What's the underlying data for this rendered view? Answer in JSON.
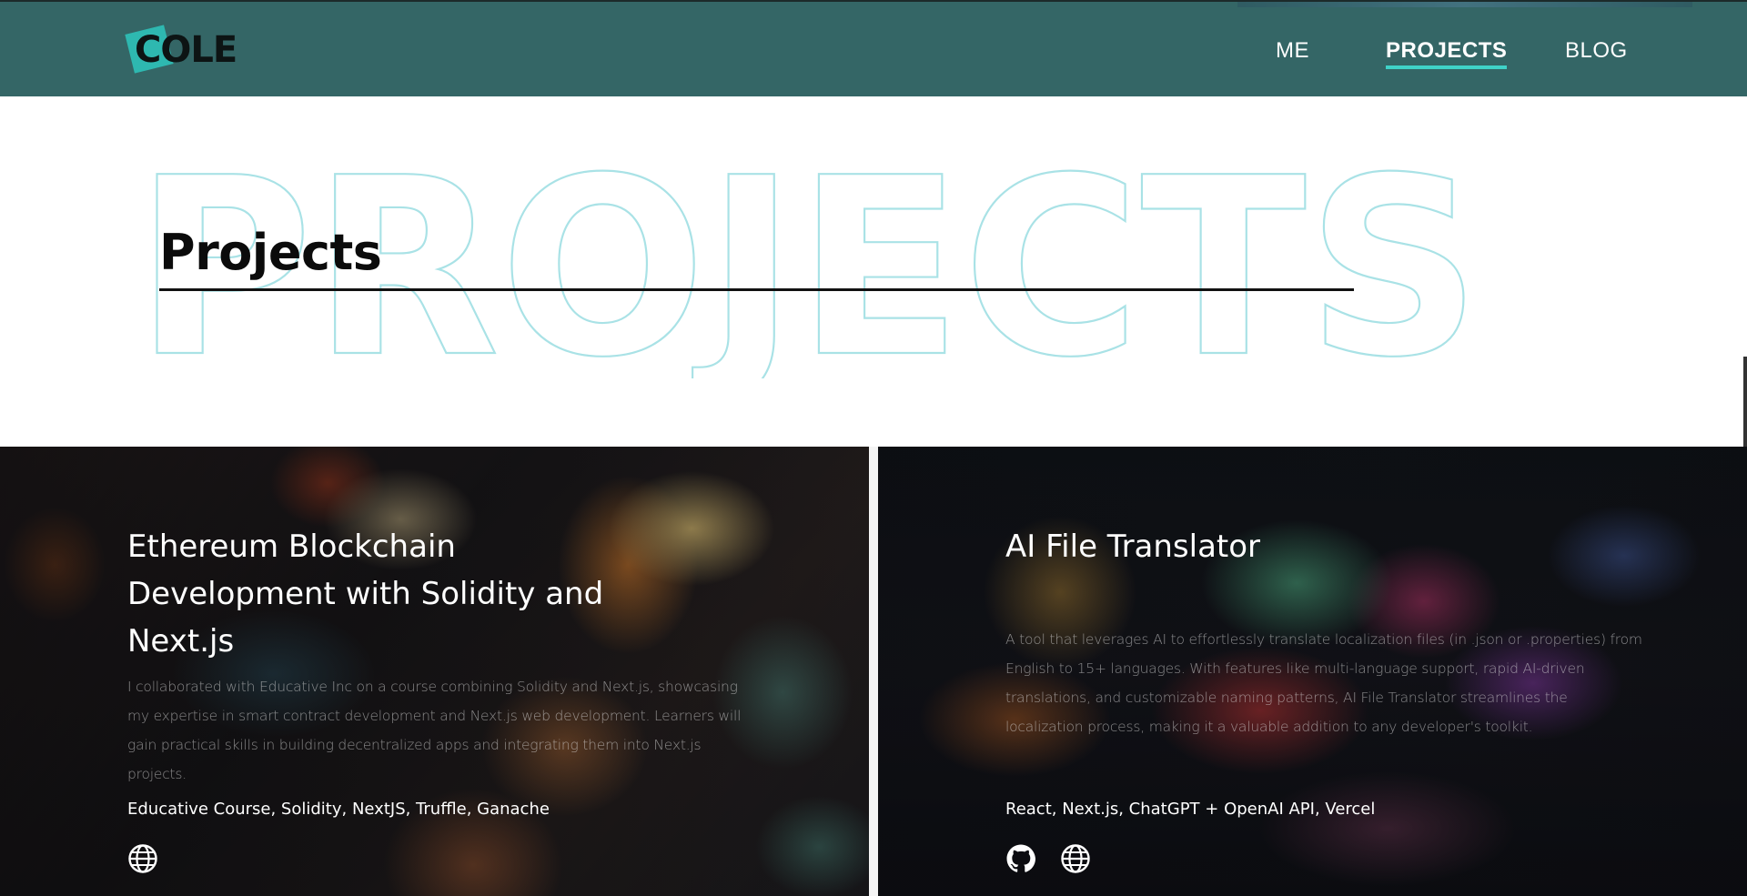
{
  "header": {
    "logo_text": "COLE",
    "nav": [
      {
        "label": "ME",
        "active": false
      },
      {
        "label": "PROJECTS",
        "active": true
      },
      {
        "label": "BLOG",
        "active": false
      }
    ],
    "colors": {
      "bar": "#346666",
      "accent": "#3fd2c8",
      "logo_square": "#2eb8b0"
    }
  },
  "hero": {
    "outline_word": "PROJECTS",
    "title": "Projects"
  },
  "projects": [
    {
      "title": "Ethereum Blockchain Development with Solidity and Next.js",
      "description": "I collaborated with Educative Inc on a course combining Solidity and Next.js, showcasing my expertise in smart contract development and Next.js web development. Learners will gain practical skills in building decentralized apps and integrating them into Next.js projects.",
      "tags": "Educative Course, Solidity, NextJS, Truffle, Ganache",
      "icons": [
        "globe-icon"
      ]
    },
    {
      "title": "AI File Translator",
      "description": "A tool that leverages AI to effortlessly translate localization files (in .json or .properties) from English to 15+ languages. With features like multi-language support, rapid AI-driven translations, and customizable naming patterns, AI File Translator streamlines the localization process, making it a valuable addition to any developer's toolkit.",
      "tags": "React, Next.js, ChatGPT + OpenAI API, Vercel",
      "icons": [
        "github-icon",
        "globe-icon"
      ]
    }
  ]
}
